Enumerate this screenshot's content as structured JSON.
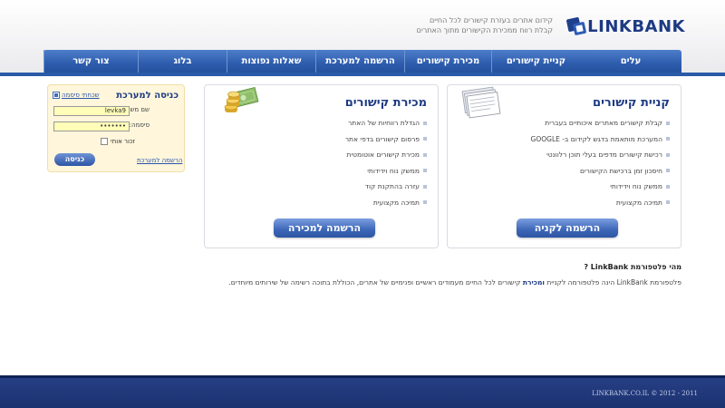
{
  "header": {
    "logo_text": "LINKBANK",
    "tagline_line1": "קידום אתרים בעזרת קישורים לכל החיים",
    "tagline_line2": "קבלת רווח ממכירת הקישורים מתוך האתרים"
  },
  "nav": {
    "items": [
      {
        "label": "עלים"
      },
      {
        "label": "קניית קישורים"
      },
      {
        "label": "מכירת קישורים"
      },
      {
        "label": "הרשמה למערכת"
      },
      {
        "label": "שאלות נפוצות"
      },
      {
        "label": "בלוג"
      },
      {
        "label": "צור קשר"
      }
    ]
  },
  "login": {
    "title": "כניסה למערכת",
    "forgot_label": "שכחתי סיסמה",
    "username_label": "שם משתמש:",
    "username_value": "levka9",
    "password_label": "סיסמה:",
    "password_value": "•••••••",
    "remember_label": "זכור אותי",
    "submit_label": "כניסה",
    "register_label": "הרשמה למערכת"
  },
  "buy_panel": {
    "title": "קניית קישורים",
    "items": [
      "קבלת קישורים מאתרים איכותיים בעברית",
      "המערכת מותאמת בדגש לקידום ב- GOOGLE",
      "רכישת קישורים מדפים בעלי תוכן רלוונטי",
      "חיסכון זמן ברכישת הקישורים",
      "ממשק נוח וידידותי",
      "תמיכה מקצועית"
    ],
    "button_label": "הרשמה לקניה"
  },
  "sell_panel": {
    "title": "מכירת קישורים",
    "items": [
      "הגדלת רווחיות של האתר",
      "פרסום קישורים בדפי אתר",
      "מכירת קישורים אוטומטית",
      "ממשק נוח וידידותי",
      "עזרה בהתקנת קוד",
      "תמיכה מקצועית"
    ],
    "button_label": "הרשמה למכירה"
  },
  "about": {
    "title": "מהי פלטפורמת LinkBank ?",
    "text_part1": "פלטפורמת LinkBank הינה פלטפורמה לקניית ",
    "text_bold": "ומכירת",
    "text_part2": " קישורים לכל החיים מעמודים ראשיים ופנימיים של אתרים, הכוללת בתוכה רשימה של שירותים מיוחדים."
  },
  "footer": {
    "copyright": "LINKBANK.CO.IL © 2012 - 2011"
  },
  "colors": {
    "brand": "#1d3a82",
    "nav": "#2f5eaf",
    "footer": "#1b3270",
    "login_bg": "#fff6dc"
  }
}
